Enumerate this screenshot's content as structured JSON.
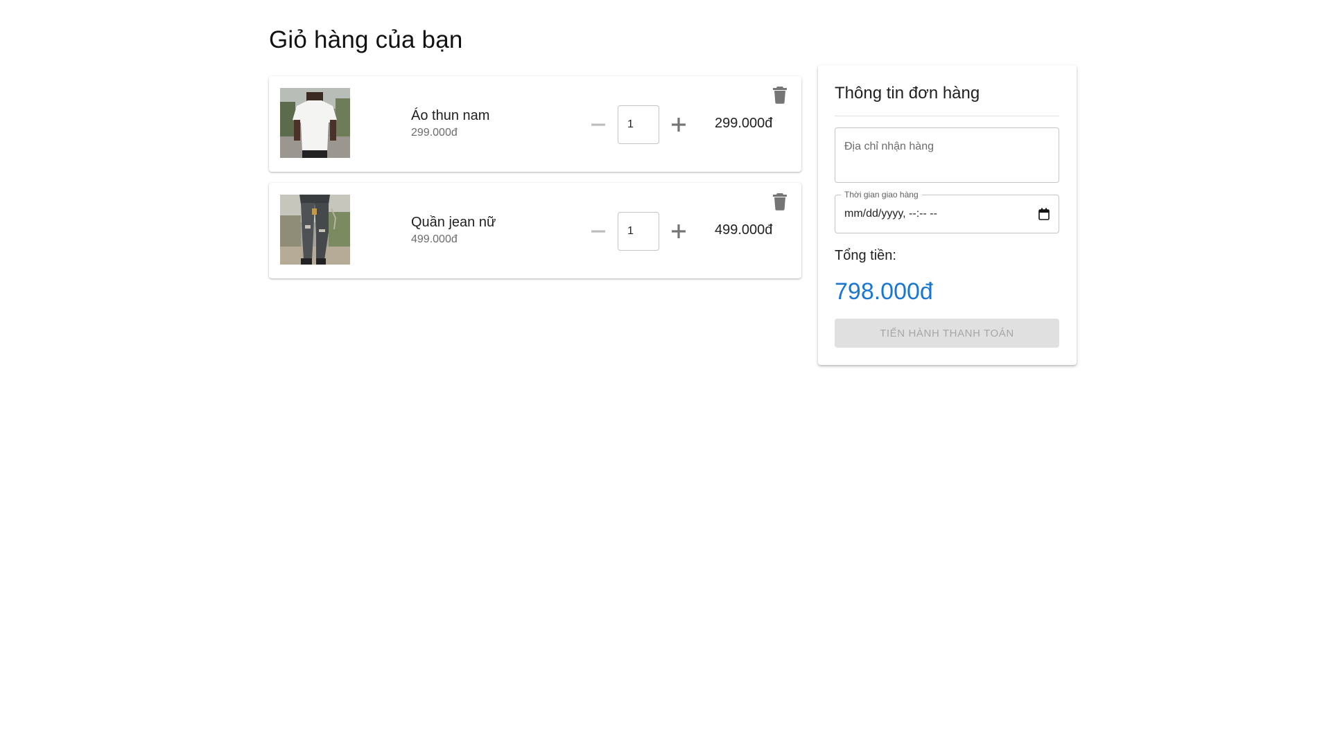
{
  "page": {
    "title": "Giỏ hàng của bạn"
  },
  "cart": {
    "items": [
      {
        "name": "Áo thun nam",
        "unit_price": "299.000đ",
        "quantity": "1",
        "line_total": "299.000đ",
        "image": "white-tshirt-man-photo"
      },
      {
        "name": "Quần jean nữ",
        "unit_price": "499.000đ",
        "quantity": "1",
        "line_total": "499.000đ",
        "image": "ripped-jeans-photo"
      }
    ],
    "icons": {
      "decrement": "minus-icon",
      "increment": "plus-icon",
      "delete": "trash-icon"
    }
  },
  "summary": {
    "title": "Thông tin đơn hàng",
    "address_placeholder": "Địa chỉ nhận hàng",
    "delivery_label": "Thời gian giao hàng",
    "delivery_value": "mm/dd/yyyy, --:-- --",
    "total_label": "Tổng tiền:",
    "total_value": "798.000đ",
    "checkout_label": "TIẾN HÀNH THANH TOÁN",
    "checkout_disabled": true
  },
  "colors": {
    "accent": "#1976d2",
    "icon": "#757575",
    "icon_disabled": "#bdbdbd",
    "button_disabled_bg": "#e0e0e0",
    "button_disabled_text": "#a6a6a6"
  }
}
